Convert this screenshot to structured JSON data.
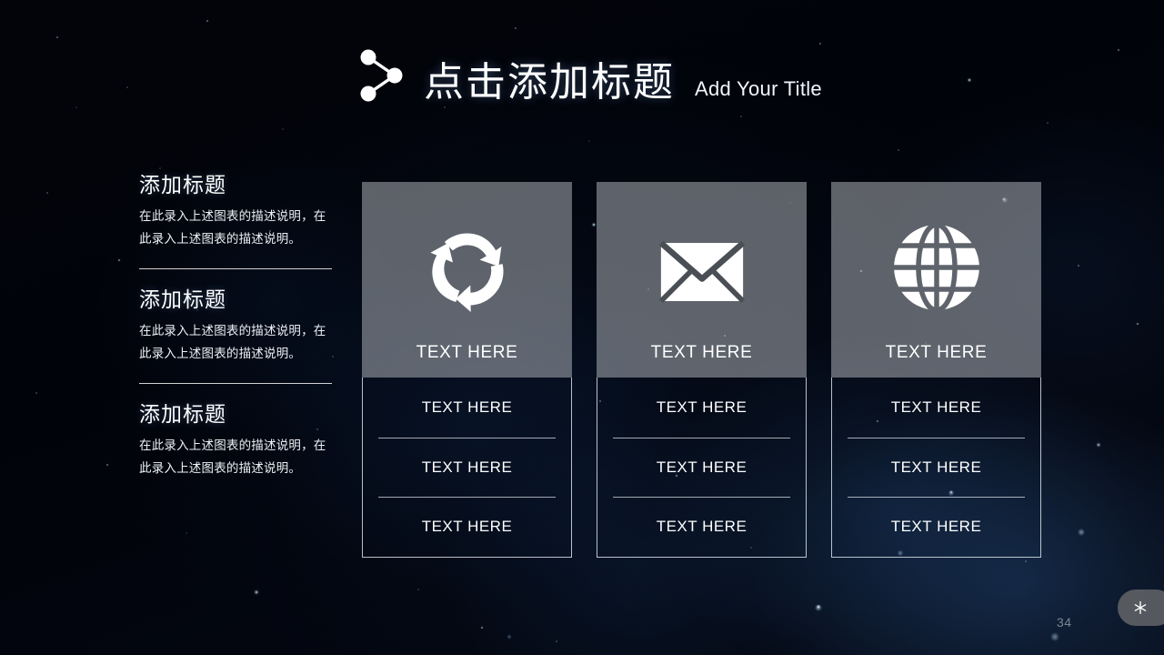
{
  "slide": {
    "page_number": "34",
    "background_color": "#02040a",
    "accent_color": "#ffffff",
    "card_overlay_color": "#babec4"
  },
  "header": {
    "icon": "share-nodes-icon",
    "title_cn": "点击添加标题",
    "title_en": "Add Your Title"
  },
  "left_column": {
    "blocks": [
      {
        "heading": "添加标题",
        "body": "在此录入上述图表的描述说明，在此录入上述图表的描述说明。"
      },
      {
        "heading": "添加标题",
        "body": "在此录入上述图表的描述说明，在此录入上述图表的描述说明。"
      },
      {
        "heading": "添加标题",
        "body": "在此录入上述图表的描述说明，在此录入上述图表的描述说明。"
      }
    ]
  },
  "cards": [
    {
      "icon": "recycle-icon",
      "headline": "TEXT HERE",
      "rows": [
        "TEXT HERE",
        "TEXT HERE",
        "TEXT HERE"
      ]
    },
    {
      "icon": "envelope-icon",
      "headline": "TEXT HERE",
      "rows": [
        "TEXT HERE",
        "TEXT HERE",
        "TEXT HERE"
      ]
    },
    {
      "icon": "globe-icon",
      "headline": "TEXT HERE",
      "rows": [
        "TEXT HERE",
        "TEXT HERE",
        "TEXT HERE"
      ]
    }
  ],
  "footer": {
    "corner_icon": "snowflake-icon"
  }
}
